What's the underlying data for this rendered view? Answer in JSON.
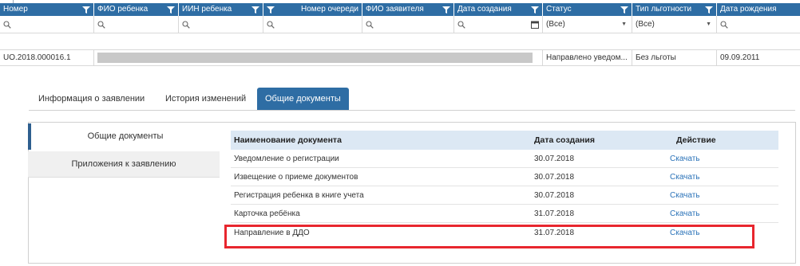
{
  "grid": {
    "columns": [
      {
        "label": "Номер",
        "filter": true
      },
      {
        "label": "ФИО ребенка",
        "filter": true
      },
      {
        "label": "ИИН ребенка",
        "filter": true
      },
      {
        "label": "Номер очереди",
        "filter": true
      },
      {
        "label": "ФИО заявителя",
        "filter": true
      },
      {
        "label": "Дата создания",
        "filter": true
      },
      {
        "label": "Статус",
        "filter": true
      },
      {
        "label": "Тип льготности",
        "filter": true
      },
      {
        "label": "Дата рождения",
        "filter": false
      }
    ],
    "filters": {
      "status": "(Все)",
      "benefit": "(Все)"
    },
    "row": {
      "number": "UO.2018.000016.1",
      "status": "Направлено уведом...",
      "benefit": "Без льготы",
      "birth_date": "09.09.2011"
    }
  },
  "tabs": [
    {
      "label": "Информация о заявлении",
      "active": false
    },
    {
      "label": "История изменений",
      "active": false
    },
    {
      "label": "Общие документы",
      "active": true
    }
  ],
  "side_menu": [
    {
      "label": "Общие документы",
      "active": true
    },
    {
      "label": "Приложения к заявлению",
      "active": false
    }
  ],
  "documents": {
    "headers": {
      "name": "Наименование документа",
      "date": "Дата создания",
      "action": "Действие"
    },
    "rows": [
      {
        "name": "Уведомление о регистрации",
        "date": "30.07.2018",
        "action": "Скачать"
      },
      {
        "name": "Извещение о приеме документов",
        "date": "30.07.2018",
        "action": "Скачать"
      },
      {
        "name": "Регистрация ребенка в книге учета",
        "date": "30.07.2018",
        "action": "Скачать"
      },
      {
        "name": "Карточка ребёнка",
        "date": "31.07.2018",
        "action": "Скачать"
      },
      {
        "name": "Направление в ДДО",
        "date": "31.07.2018",
        "action": "Скачать"
      }
    ]
  },
  "colors": {
    "header_bg": "#2e6da4",
    "link": "#2a72b8",
    "highlight": "#e8262e"
  }
}
